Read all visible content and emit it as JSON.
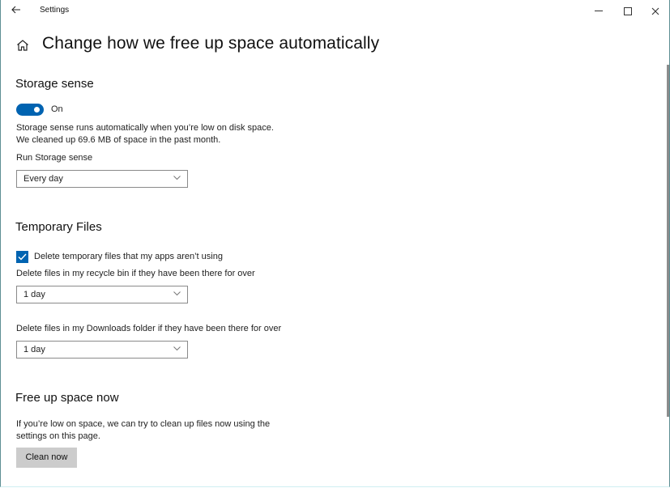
{
  "window": {
    "title": "Settings",
    "controls": {
      "minimize": "minimize",
      "maximize": "maximize",
      "close": "close"
    }
  },
  "header": {
    "title": "Change how we free up space automatically"
  },
  "storage_sense": {
    "title": "Storage sense",
    "toggle_state": "On",
    "toggle_on": true,
    "description_line1": "Storage sense runs automatically when you’re low on disk space.",
    "description_line2": "We cleaned up 69.6 MB of space in the past month.",
    "run_label": "Run Storage sense",
    "run_value": "Every day"
  },
  "temporary_files": {
    "title": "Temporary Files",
    "checkbox_label": "Delete temporary files that my apps aren’t using",
    "checkbox_checked": true,
    "recycle_label": "Delete files in my recycle bin if they have been there for over",
    "recycle_value": "1 day",
    "downloads_label": "Delete files in my Downloads folder if they have been there for over",
    "downloads_value": "1 day"
  },
  "free_up": {
    "title": "Free up space now",
    "description_line1": "If you’re low on space, we can try to clean up files now using the",
    "description_line2": "settings on this page.",
    "button_label": "Clean now"
  },
  "colors": {
    "accent": "#0063b1",
    "button_bg": "#cccccc"
  }
}
